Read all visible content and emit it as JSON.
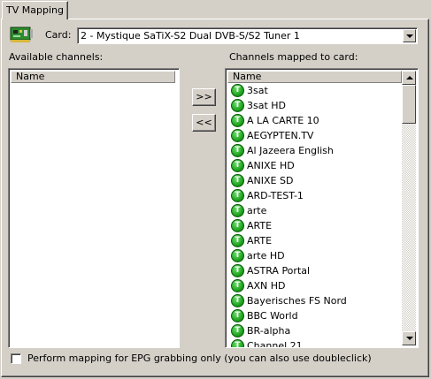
{
  "tab": {
    "label": "TV Mapping"
  },
  "card": {
    "label": "Card:",
    "selected": "2 - Mystique SaTiX-S2 Dual DVB-S/S2 Tuner 1"
  },
  "available": {
    "label": "Available channels:",
    "header": "Name"
  },
  "mapped": {
    "label": "Channels mapped to card:",
    "header": "Name",
    "icon_letter": "T",
    "channels": [
      "3sat",
      "3sat HD",
      "A LA CARTE 10",
      "AEGYPTEN.TV",
      "Al Jazeera English",
      "ANIXE HD",
      "ANIXE SD",
      "ARD-TEST-1",
      "arte",
      "ARTE",
      "ARTE",
      "arte HD",
      "ASTRA Portal",
      "AXN HD",
      "Bayerisches FS Nord",
      "BBC World",
      "BR-alpha",
      "Channel 21"
    ]
  },
  "buttons": {
    "add": ">>",
    "remove": "<<"
  },
  "epg_option": {
    "label": "Perform mapping for EPG grabbing only (you can also use doubleclick)",
    "checked": false
  }
}
